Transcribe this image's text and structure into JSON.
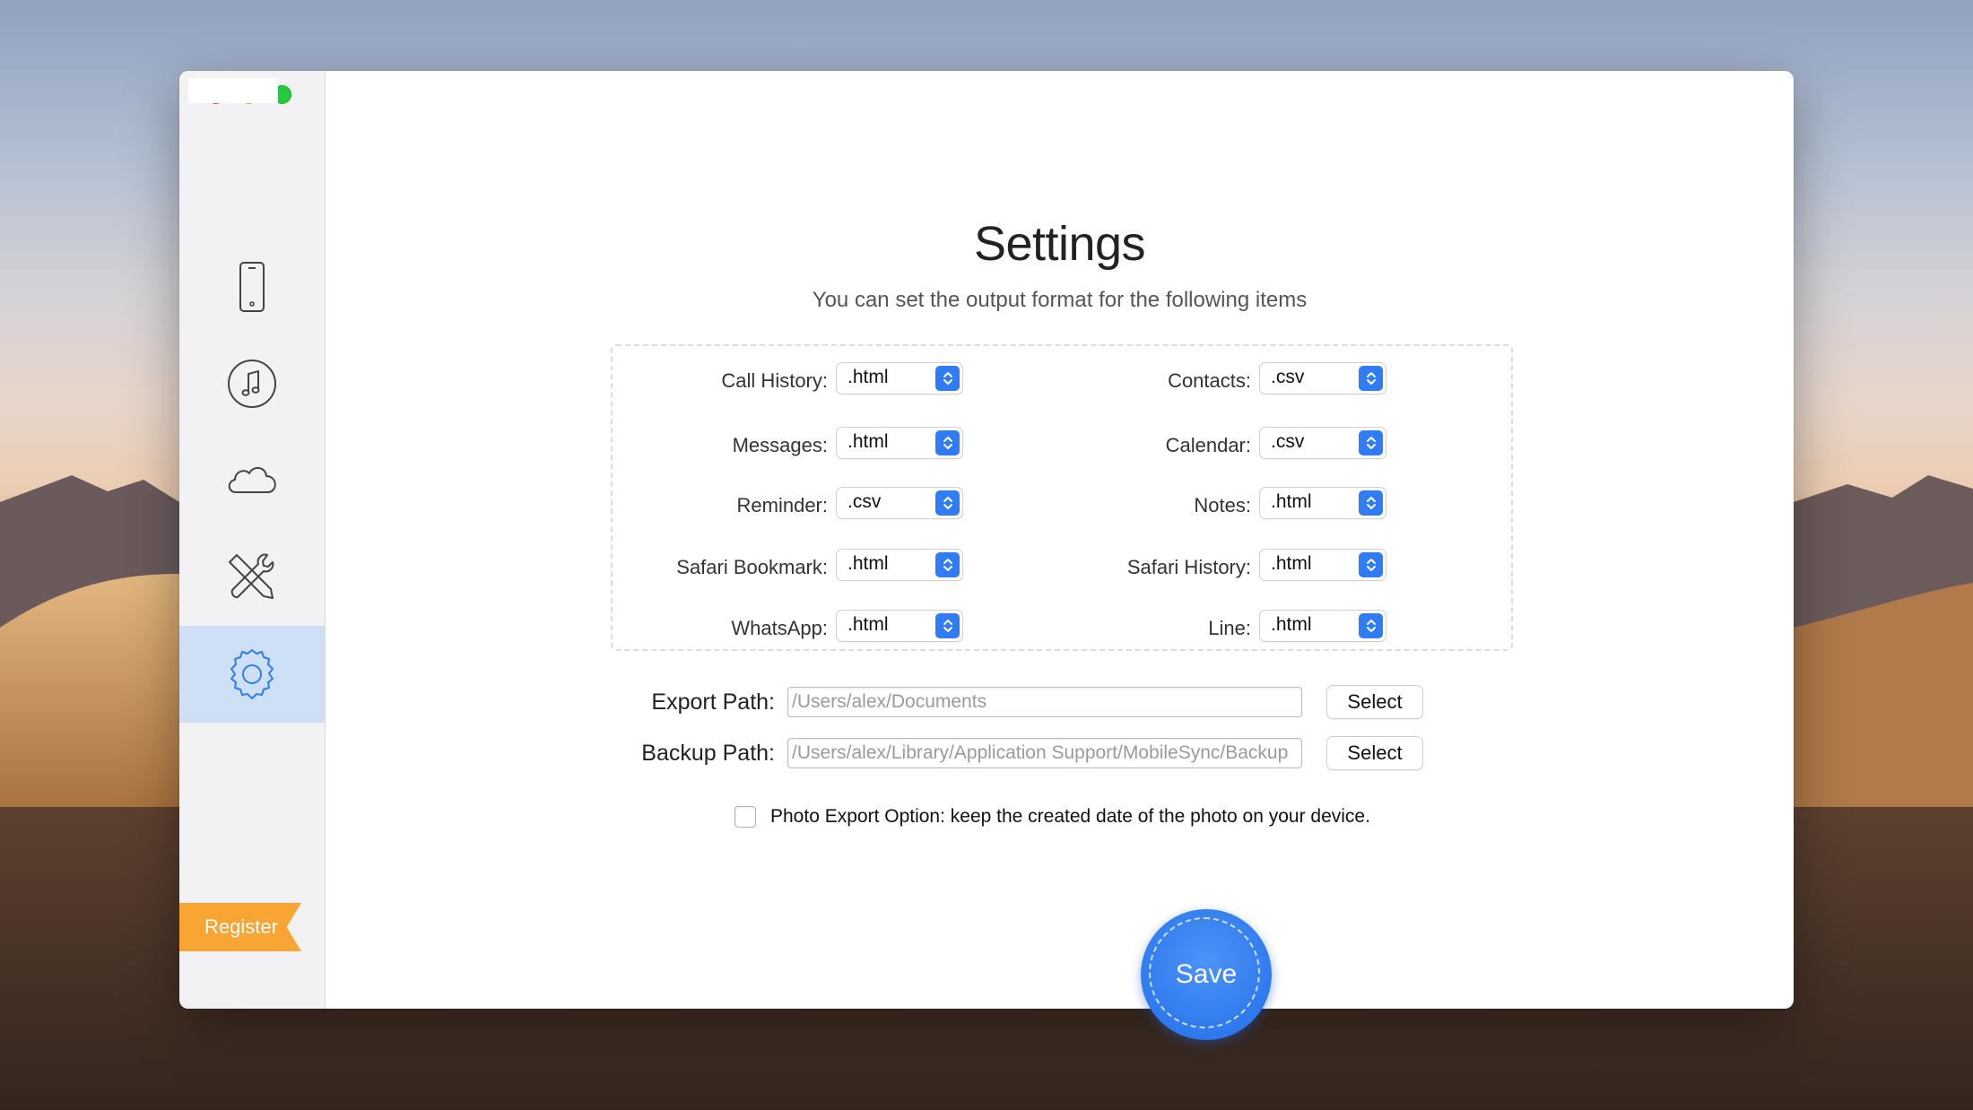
{
  "window": {
    "traffic_lights": [
      "close",
      "minimize",
      "zoom"
    ]
  },
  "sidebar": {
    "items": [
      {
        "name": "phone",
        "icon": "phone-icon",
        "active": false
      },
      {
        "name": "music",
        "icon": "music-note-icon",
        "active": false
      },
      {
        "name": "cloud",
        "icon": "cloud-icon",
        "active": false
      },
      {
        "name": "tools",
        "icon": "tools-icon",
        "active": false
      },
      {
        "name": "settings",
        "icon": "gear-icon",
        "active": true
      }
    ],
    "register_label": "Register"
  },
  "settings": {
    "title": "Settings",
    "subtitle": "You can set the output format for the following items",
    "formats_left": [
      {
        "label": "Call History:",
        "value": ".html"
      },
      {
        "label": "Messages:",
        "value": ".html"
      },
      {
        "label": "Reminder:",
        "value": ".csv"
      },
      {
        "label": "Safari Bookmark:",
        "value": ".html"
      },
      {
        "label": "WhatsApp:",
        "value": ".html"
      }
    ],
    "formats_right": [
      {
        "label": "Contacts:",
        "value": ".csv"
      },
      {
        "label": "Calendar:",
        "value": ".csv"
      },
      {
        "label": "Notes:",
        "value": ".html"
      },
      {
        "label": "Safari History:",
        "value": ".html"
      },
      {
        "label": "Line:",
        "value": ".html"
      }
    ],
    "export_path": {
      "label": "Export Path:",
      "placeholder": "/Users/alex/Documents",
      "button": "Select"
    },
    "backup_path": {
      "label": "Backup Path:",
      "placeholder": "/Users/alex/Library/Application Support/MobileSync/Backup",
      "button": "Select"
    },
    "photo_option": {
      "checked": false,
      "text": "Photo Export Option: keep the created date of the photo on your device."
    },
    "save_label": "Save"
  },
  "colors": {
    "accent": "#2f7cf6",
    "register": "#f9a533",
    "sidebar_active": "#cde0f6"
  }
}
